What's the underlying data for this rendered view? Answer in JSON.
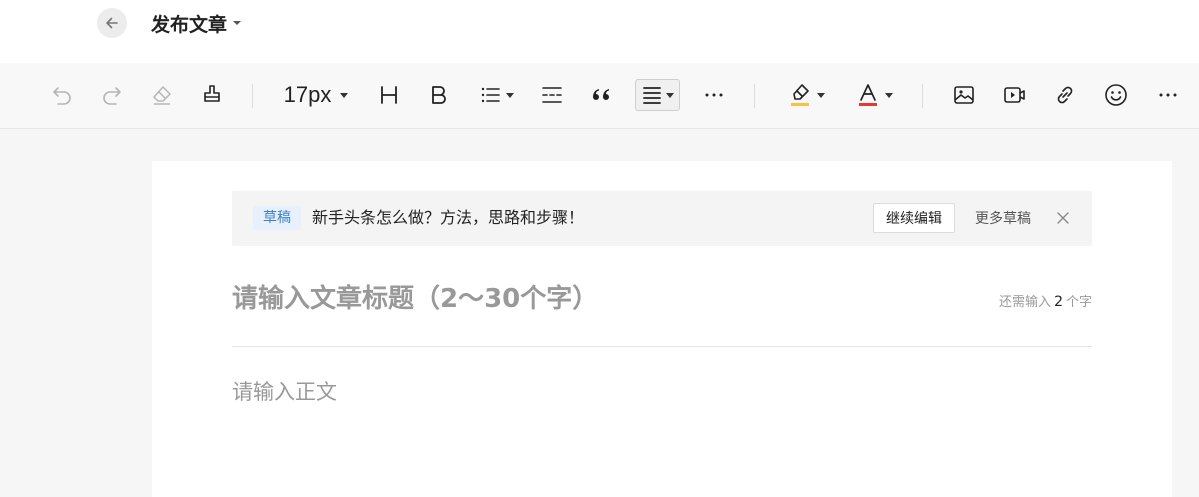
{
  "header": {
    "title": "发布文章",
    "back_icon": "arrow-left-icon"
  },
  "toolbar": {
    "font_size": "17px",
    "icons": [
      "undo-icon",
      "redo-icon",
      "eraser-icon",
      "format-painter-icon",
      "heading-icon",
      "bold-icon",
      "list-icon",
      "divider-icon",
      "quote-icon",
      "align-icon",
      "more-icon",
      "highlight-icon",
      "font-color-icon",
      "image-icon",
      "video-icon",
      "link-icon",
      "emoji-icon",
      "more-tools-icon"
    ],
    "colors": {
      "highlight_underline": "#f5c342",
      "font_color_underline": "#e53935"
    }
  },
  "draft": {
    "tag": "草稿",
    "title": "新手头条怎么做？方法，思路和步骤！",
    "continue_label": "继续编辑",
    "more_label": "更多草稿"
  },
  "editor": {
    "title_placeholder": "请输入文章标题（2～30个字）",
    "counter_prefix": "还需输入",
    "counter_value": "2",
    "counter_suffix": "个字",
    "body_placeholder": "请输入正文"
  },
  "colors": {
    "accent": "#3c7fd0",
    "tag_bg": "#e8f1fb"
  }
}
